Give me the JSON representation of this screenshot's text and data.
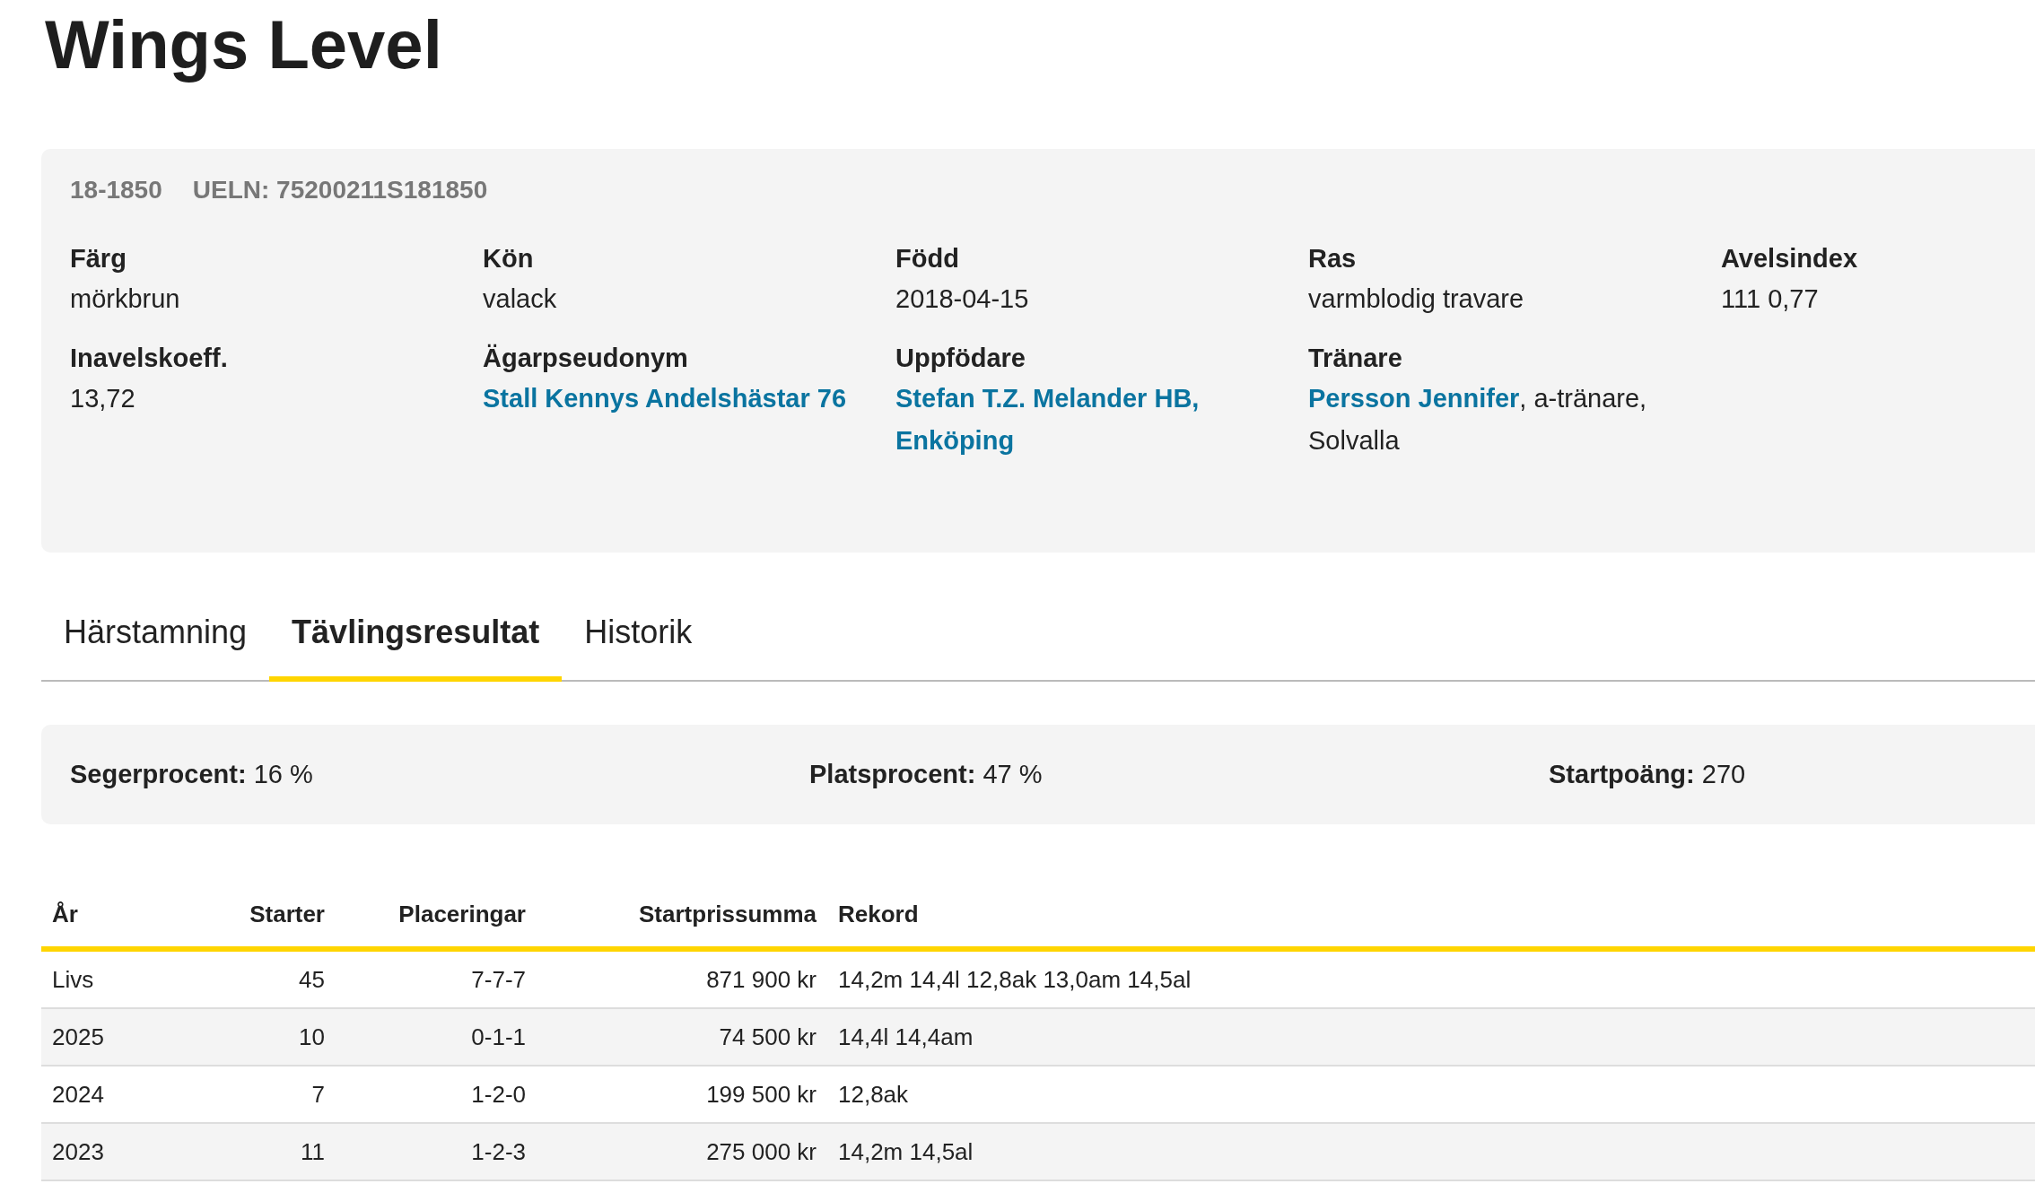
{
  "title": "Wings Level",
  "info": {
    "reg_number": "18-1850",
    "ueln": "UELN: 75200211S181850",
    "fields": [
      {
        "label": "Färg",
        "kind": "plain",
        "value": "mörkbrun"
      },
      {
        "label": "Kön",
        "kind": "plain",
        "value": "valack"
      },
      {
        "label": "Född",
        "kind": "plain",
        "value": "2018-04-15"
      },
      {
        "label": "Ras",
        "kind": "plain",
        "value": "varmblodig travare"
      },
      {
        "label": "Avelsindex",
        "kind": "plain",
        "value": "111 0,77"
      },
      {
        "label": "Inavelskoeff.",
        "kind": "plain",
        "value": "13,72"
      },
      {
        "label": "Ägarpseudonym",
        "kind": "link",
        "value": "Stall Kennys Andelshästar 76"
      },
      {
        "label": "Uppfödare",
        "kind": "link",
        "value": "Stefan T.Z. Melander HB, Enköping"
      },
      {
        "label": "Tränare",
        "kind": "link_text",
        "value": "Persson Jennifer",
        "rest": ", a-tränare, Solvalla"
      }
    ]
  },
  "tabs": [
    {
      "label": "Härstamning",
      "selected": false
    },
    {
      "label": "Tävlingsresultat",
      "selected": true
    },
    {
      "label": "Historik",
      "selected": false
    }
  ],
  "stats": [
    {
      "label": "Segerprocent:",
      "value": "16 %"
    },
    {
      "label": "Platsprocent:",
      "value": "47 %"
    },
    {
      "label": "Startpoäng:",
      "value": "270"
    }
  ],
  "table": {
    "columns": [
      "År",
      "Starter",
      "Placeringar",
      "Startprissumma",
      "Rekord"
    ],
    "rows": [
      [
        "Livs",
        "45",
        "7-7-7",
        "871 900 kr",
        "14,2m 14,4l 12,8ak 13,0am 14,5al"
      ],
      [
        "2025",
        "10",
        "0-1-1",
        "74 500 kr",
        "14,4l 14,4am"
      ],
      [
        "2024",
        "7",
        "1-2-0",
        "199 500 kr",
        "12,8ak"
      ],
      [
        "2023",
        "11",
        "1-2-3",
        "275 000 kr",
        "14,2m 14,5al"
      ]
    ]
  }
}
